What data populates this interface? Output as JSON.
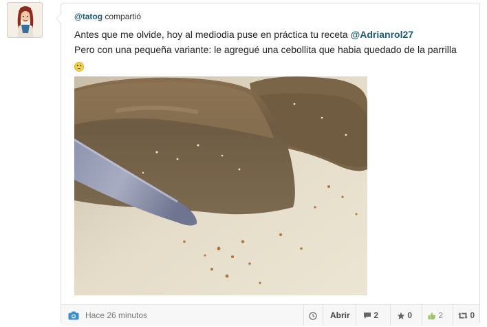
{
  "post": {
    "username": "@tatog",
    "action": "compartió",
    "line1_text": "Antes que me olvide, hoy al mediodia puse en práctica tu receta ",
    "line1_mention": "@Adrianrol27",
    "line2_text": "Pero con una pequeña variante: le agregué una cebollita que habia quedado de la parrilla",
    "emoji_icon": "smiley-emoji"
  },
  "footer": {
    "timestamp": "Hace 26 minutos",
    "open_label": "Abrir",
    "comments_count": "2",
    "favorites_count": "0",
    "likes_count": "2",
    "reshares_count": "0",
    "icons": {
      "photo": "camera-icon",
      "time": "clock-icon",
      "comments": "comment-icon",
      "favorites": "star-icon",
      "likes": "thumbs-up-icon",
      "reshares": "retweet-icon"
    }
  },
  "colors": {
    "link": "#1c5a76",
    "camera": "#3a8fd1"
  }
}
